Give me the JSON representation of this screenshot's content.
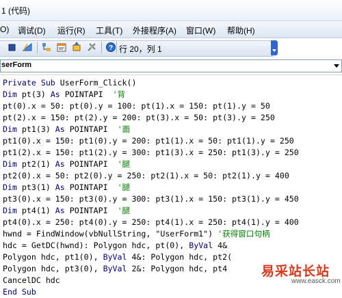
{
  "window": {
    "title": "1 (代码)"
  },
  "menu": [
    {
      "label": "O)"
    },
    {
      "label": "调试(D)"
    },
    {
      "label": "运行(R)"
    },
    {
      "label": "工具(T)"
    },
    {
      "label": "外接程序(A)"
    },
    {
      "label": "窗口(W)"
    },
    {
      "label": "帮助(H)"
    }
  ],
  "toolbar": {
    "cursor_position": "行 20，列 1"
  },
  "object_combo": {
    "value": "serForm"
  },
  "code": [
    [
      {
        "t": "Private Sub ",
        "c": "kw"
      },
      {
        "t": "UserForm_Click()",
        "c": ""
      }
    ],
    [
      {
        "t": "Dim ",
        "c": "kw"
      },
      {
        "t": "pt(3) ",
        "c": ""
      },
      {
        "t": "As ",
        "c": "kw"
      },
      {
        "t": "POINTAPI  ",
        "c": ""
      },
      {
        "t": "'背",
        "c": "cm"
      }
    ],
    [
      {
        "t": "pt(0).x = 50: pt(0).y = 100: pt(1).x = 150: pt(1).y = 50",
        "c": ""
      }
    ],
    [
      {
        "t": "pt(2).x = 150: pt(2).y = 200: pt(3).x = 50: pt(3).y = 250",
        "c": ""
      }
    ],
    [
      {
        "t": "Dim ",
        "c": "kw"
      },
      {
        "t": "pt1(3) ",
        "c": ""
      },
      {
        "t": "As ",
        "c": "kw"
      },
      {
        "t": "POINTAPI  ",
        "c": ""
      },
      {
        "t": "'面",
        "c": "cm"
      }
    ],
    [
      {
        "t": "pt1(0).x = 150: pt1(0).y = 200: pt1(1).x = 50: pt1(1).y = 250",
        "c": ""
      }
    ],
    [
      {
        "t": "pt1(2).x = 150: pt1(2).y = 300: pt1(3).x = 250: pt1(3).y = 250",
        "c": ""
      }
    ],
    [
      {
        "t": "Dim ",
        "c": "kw"
      },
      {
        "t": "pt2(1) ",
        "c": ""
      },
      {
        "t": "As ",
        "c": "kw"
      },
      {
        "t": "POINTAPI  ",
        "c": ""
      },
      {
        "t": "'腿",
        "c": "cm"
      }
    ],
    [
      {
        "t": "pt2(0).x = 50: pt2(0).y = 250: pt2(1).x = 50: pt2(1).y = 400",
        "c": ""
      }
    ],
    [
      {
        "t": "Dim ",
        "c": "kw"
      },
      {
        "t": "pt3(1) ",
        "c": ""
      },
      {
        "t": "As ",
        "c": "kw"
      },
      {
        "t": "POINTAPI  ",
        "c": ""
      },
      {
        "t": "'腿",
        "c": "cm"
      }
    ],
    [
      {
        "t": "pt3(0).x = 150: pt3(0).y = 300: pt3(1).x = 150: pt3(1).y = 450",
        "c": ""
      }
    ],
    [
      {
        "t": "Dim ",
        "c": "kw"
      },
      {
        "t": "pt4(1) ",
        "c": ""
      },
      {
        "t": "As ",
        "c": "kw"
      },
      {
        "t": "POINTAPI  ",
        "c": ""
      },
      {
        "t": "'腿",
        "c": "cm"
      }
    ],
    [
      {
        "t": "pt4(0).x = 250: pt4(0).y = 250: pt4(1).x = 250: pt4(1).y = 400",
        "c": ""
      }
    ],
    [
      {
        "t": "hwnd = FindWindow(vbNullString, \"UserForm1\") ",
        "c": ""
      },
      {
        "t": "'获得窗口句柄",
        "c": "cm"
      }
    ],
    [
      {
        "t": "hdc = GetDC(hwnd): Polygon hdc, pt(0), ",
        "c": ""
      },
      {
        "t": "ByVal ",
        "c": "kw"
      },
      {
        "t": "4&",
        "c": ""
      }
    ],
    [
      {
        "t": "Polygon hdc, pt1(0), ",
        "c": ""
      },
      {
        "t": "ByVal ",
        "c": "kw"
      },
      {
        "t": "4&: Polygon hdc, pt2(",
        "c": ""
      }
    ],
    [
      {
        "t": "Polygon hdc, pt3(0), ",
        "c": ""
      },
      {
        "t": "ByVal ",
        "c": "kw"
      },
      {
        "t": "2&: Polygon hdc, pt4",
        "c": ""
      }
    ],
    [
      {
        "t": "CancelDC hdc",
        "c": ""
      }
    ],
    [
      {
        "t": "End Sub",
        "c": "kw"
      }
    ]
  ],
  "watermark": {
    "title": "易采站长站",
    "url": "www.easck.com"
  },
  "colors": {
    "keyword": "#00007f",
    "comment": "#008000",
    "watermark": "#d7391c"
  }
}
